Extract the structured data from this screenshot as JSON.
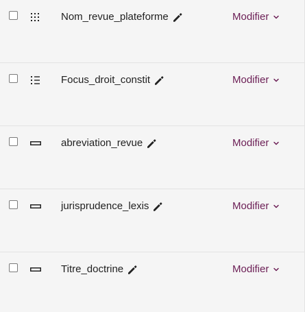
{
  "fields": [
    {
      "name": "Nom_revue_plateforme",
      "type_icon": "grid-list-icon",
      "action_label": "Modifier",
      "edit_icon": "pencil-icon",
      "menu_icon": "chevron-down-icon"
    },
    {
      "name": "Focus_droit_constit",
      "type_icon": "bullet-list-icon",
      "action_label": "Modifier",
      "edit_icon": "pencil-icon",
      "menu_icon": "chevron-down-icon"
    },
    {
      "name": "abreviation_revue",
      "type_icon": "text-field-icon",
      "action_label": "Modifier",
      "edit_icon": "pencil-icon",
      "menu_icon": "chevron-down-icon"
    },
    {
      "name": "jurisprudence_lexis",
      "type_icon": "text-field-icon",
      "action_label": "Modifier",
      "edit_icon": "pencil-icon",
      "menu_icon": "chevron-down-icon"
    },
    {
      "name": "Titre_doctrine",
      "type_icon": "text-field-icon",
      "action_label": "Modifier",
      "edit_icon": "pencil-icon",
      "menu_icon": "chevron-down-icon"
    }
  ],
  "colors": {
    "accent": "#6b1e55",
    "background": "#f5f5f5",
    "divider": "#e2e2e2",
    "text": "#1f1f1f"
  }
}
